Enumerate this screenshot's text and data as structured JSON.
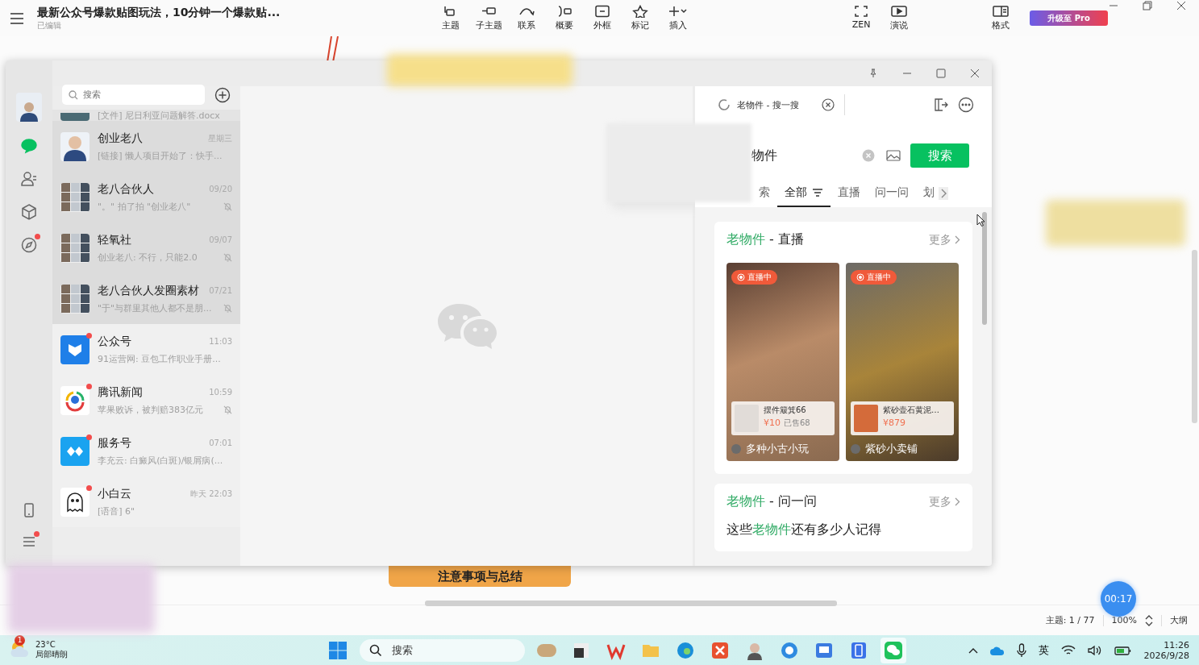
{
  "editor": {
    "title": "最新公众号爆款贴图玩法，10分钟一个爆款贴...",
    "subtitle": "已编辑",
    "tool_groups": [
      [
        "主题",
        "子主题",
        "联系",
        "概要",
        "外框",
        "标记",
        "插入"
      ],
      [
        "ZEN",
        "演说"
      ],
      [
        "格式"
      ]
    ],
    "upgrade": "升级至 Pro"
  },
  "mindmap": {
    "node": "注意事项与总结",
    "topics": "主题: 1 / 77",
    "zoom": "100%",
    "outline": "大纲"
  },
  "timer": "00:17",
  "wechat": {
    "nav": [
      {
        "kind": "chat",
        "selected": true,
        "dot": false
      },
      {
        "kind": "contacts",
        "selected": false,
        "dot": false
      },
      {
        "kind": "box",
        "selected": false,
        "dot": false
      },
      {
        "kind": "compass",
        "selected": false,
        "dot": true
      }
    ],
    "nav_bottom": [
      {
        "kind": "phone",
        "dot": false
      },
      {
        "kind": "menu",
        "dot": true
      }
    ],
    "search_placeholder": "搜索",
    "partial_preview": "[文件] 尼日利亚问题解答.docx",
    "chats": [
      {
        "kind": "person",
        "name": "创业老八",
        "time": "星期三",
        "preview": "[链接] 懒人项目开始了：快手...",
        "pinned": true,
        "muted": false,
        "badge": false
      },
      {
        "kind": "group",
        "name": "老八合伙人",
        "time": "09/20",
        "preview": "\"。\" 拍了拍 \"创业老八\"",
        "pinned": true,
        "muted": true,
        "badge": false
      },
      {
        "kind": "group",
        "name": "轻氧社",
        "time": "09/07",
        "preview": "创业老八: 不行，只能2.0",
        "pinned": true,
        "muted": true,
        "badge": false
      },
      {
        "kind": "group",
        "name": "老八合伙人发圈素材",
        "time": "07/21",
        "preview": "\"于\"与群里其他人都不是朋...",
        "pinned": true,
        "muted": true,
        "badge": false
      },
      {
        "kind": "official",
        "name": "公众号",
        "time": "11:03",
        "preview": "91运营网: 豆包工作职业手册...",
        "pinned": false,
        "muted": false,
        "badge": true
      },
      {
        "kind": "news",
        "name": "腾讯新闻",
        "time": "10:59",
        "preview": "苹果败诉，被判赔383亿元",
        "pinned": false,
        "muted": true,
        "badge": true
      },
      {
        "kind": "service",
        "name": "服务号",
        "time": "07:01",
        "preview": "李充云: 白癜风(白斑)/银屑病(...",
        "pinned": false,
        "muted": false,
        "badge": true
      },
      {
        "kind": "cartoon",
        "name": "小白云",
        "time": "昨天 22:03",
        "preview": "[语音] 6\"",
        "pinned": false,
        "muted": false,
        "badge": true
      }
    ],
    "browser": {
      "tab_title": "老物件 - 搜一搜",
      "query": "物件",
      "search_button": "搜索",
      "filters": [
        {
          "label": "索",
          "selected": false,
          "filter_icon": false
        },
        {
          "label": "全部",
          "selected": true,
          "filter_icon": true
        },
        {
          "label": "直播",
          "selected": false,
          "filter_icon": false
        },
        {
          "label": "问一问",
          "selected": false,
          "filter_icon": false
        },
        {
          "label": "划",
          "selected": false,
          "filter_icon": false
        }
      ],
      "sections": [
        {
          "kind": "live",
          "highlight": "老物件",
          "title": " - 直播",
          "more": "更多",
          "items": [
            {
              "badge": "直播中",
              "product": "摆件簸箕66",
              "price": "¥10",
              "sold": "已售68",
              "thumb": false,
              "channel": "多种小古小玩"
            },
            {
              "badge": "直播中",
              "product": "紫砂壶石黄泥…",
              "price": "¥879",
              "thumb": true,
              "channel": "紫砂小卖铺"
            }
          ]
        },
        {
          "kind": "qa",
          "highlight": "老物件",
          "title": " - 问一问",
          "more": "更多",
          "question": {
            "before": "这些",
            "highlight": "老物件",
            "after": "还有多少人记得"
          }
        }
      ]
    }
  },
  "taskbar": {
    "weather": {
      "badge": "1",
      "temp": "23°C",
      "desc": "局部晴朗"
    },
    "search": "搜索",
    "apps": [
      {
        "kind": "photos",
        "selected": false
      },
      {
        "kind": "terminal",
        "selected": false
      },
      {
        "kind": "wps",
        "selected": false
      },
      {
        "kind": "folder",
        "selected": false
      },
      {
        "kind": "edge",
        "selected": false
      },
      {
        "kind": "xmind",
        "selected": false
      },
      {
        "kind": "avatar",
        "selected": false
      },
      {
        "kind": "browser",
        "selected": false
      },
      {
        "kind": "screen",
        "selected": false
      },
      {
        "kind": "phone",
        "selected": false
      },
      {
        "kind": "wechat",
        "selected": true
      }
    ],
    "ime": "英",
    "time": "11:26",
    "date": "2026/9/28"
  }
}
